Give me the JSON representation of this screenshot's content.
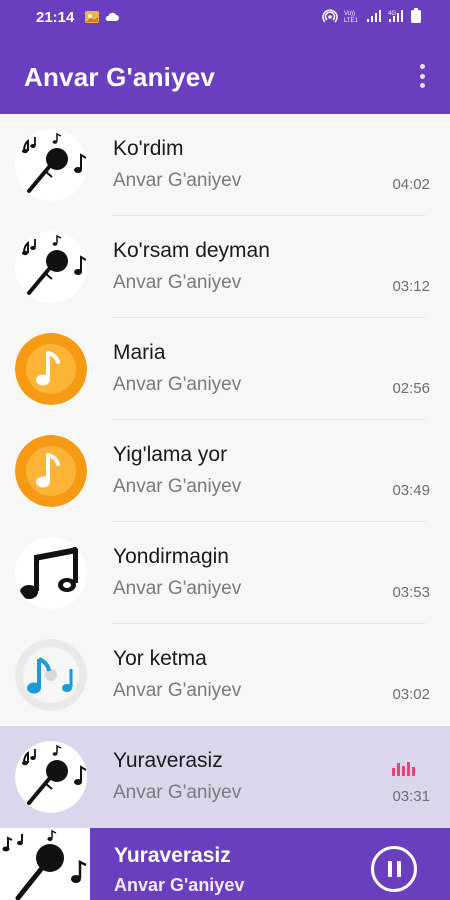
{
  "status_bar": {
    "time": "21:14",
    "icons": [
      "gallery-notification-icon",
      "cloud-icon",
      "hotspot-icon",
      "volte-signal-icon",
      "signal-icon",
      "data-signal-icon",
      "battery-icon"
    ]
  },
  "app_bar": {
    "title": "Anvar G'aniyev",
    "menu_icon": "more-vert-icon"
  },
  "songs": [
    {
      "title": "Ko'rdim",
      "artist": "Anvar G'aniyev",
      "duration": "04:02",
      "art": "microphone-notes-icon",
      "active": false
    },
    {
      "title": "Ko'rsam deyman",
      "artist": "Anvar G'aniyev",
      "duration": "03:12",
      "art": "microphone-notes-icon",
      "active": false
    },
    {
      "title": "Maria",
      "artist": "Anvar G'aniyev",
      "duration": "02:56",
      "art": "orange-music-note-icon",
      "active": false
    },
    {
      "title": "Yig'lama yor",
      "artist": "Anvar G'aniyev",
      "duration": "03:49",
      "art": "orange-music-note-icon",
      "active": false
    },
    {
      "title": "Yondirmagin",
      "artist": "Anvar G'aniyev",
      "duration": "03:53",
      "art": "black-music-notes-icon",
      "active": false
    },
    {
      "title": "Yor ketma",
      "artist": "Anvar G'aniyev",
      "duration": "03:02",
      "art": "blue-music-notes-cd-icon",
      "active": false
    },
    {
      "title": "Yuraverasiz",
      "artist": "Anvar G'aniyev",
      "duration": "03:31",
      "art": "microphone-notes-icon",
      "active": true
    }
  ],
  "now_playing": {
    "title": "Yuraverasiz",
    "artist": "Anvar G'aniyev",
    "button_icon": "pause-icon"
  },
  "colors": {
    "brand": "#6a3fbf",
    "active_row": "#dcd6ec",
    "equalizer": "#e8417a"
  }
}
